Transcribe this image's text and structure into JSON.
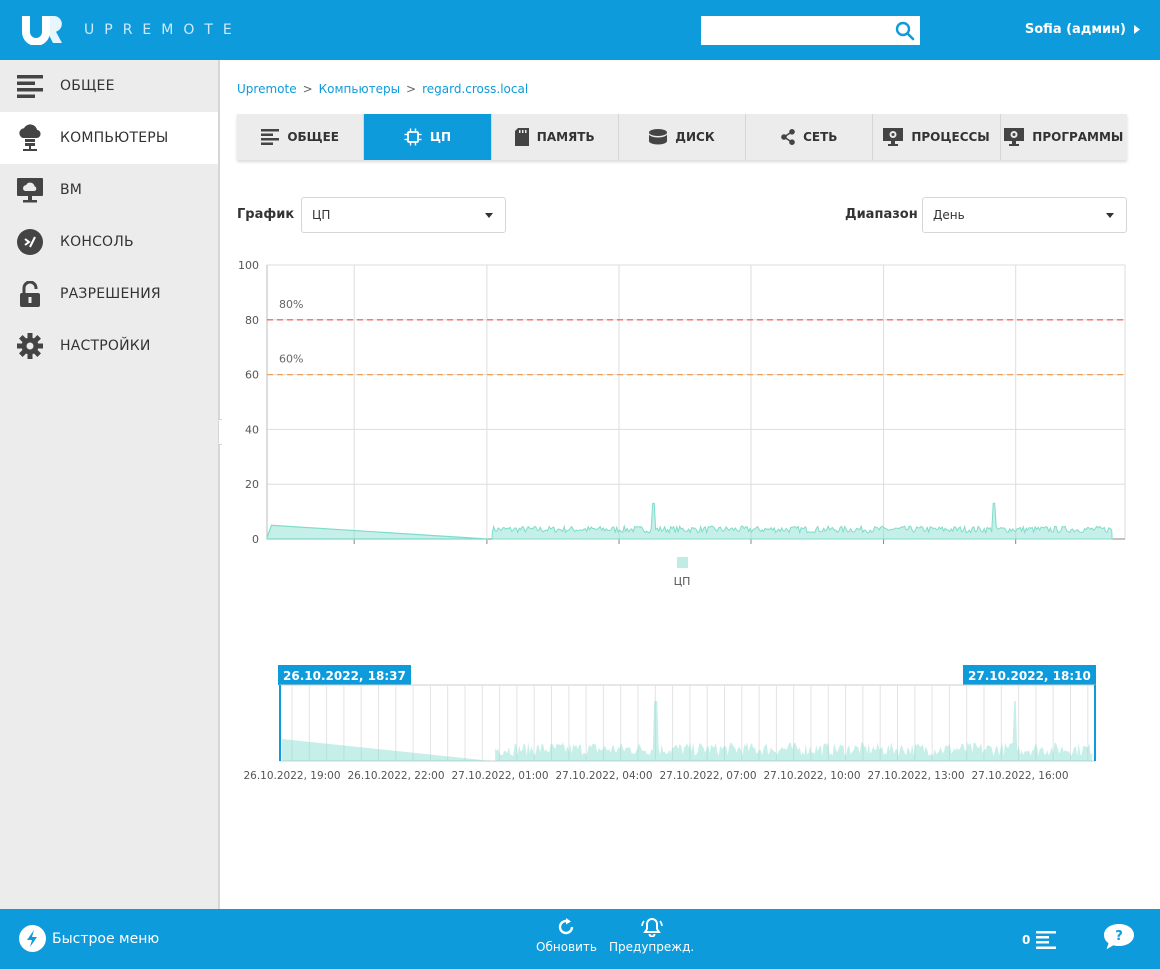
{
  "app": {
    "brand": "UPREMOTE",
    "user_label": "Sofia (админ)",
    "search": {
      "value": "",
      "placeholder": ""
    }
  },
  "sidebar": {
    "items": [
      {
        "label": "ОБЩЕЕ",
        "icon": "list-icon",
        "active": false
      },
      {
        "label": "КОМПЬЮТЕРЫ",
        "icon": "cloud-computer-icon",
        "active": true
      },
      {
        "label": "ВМ",
        "icon": "monitor-cloud-icon",
        "active": false
      },
      {
        "label": "КОНСОЛЬ",
        "icon": "console-icon",
        "active": false
      },
      {
        "label": "РАЗРЕШЕНИЯ",
        "icon": "lock-icon",
        "active": false
      },
      {
        "label": "НАСТРОЙКИ",
        "icon": "gear-icon",
        "active": false
      }
    ]
  },
  "breadcrumb": {
    "items": [
      "Upremote",
      "Компьютеры",
      "regard.cross.local"
    ],
    "separator": ">"
  },
  "tabs": [
    {
      "label": "ОБЩЕЕ",
      "icon": "list-icon",
      "active": false
    },
    {
      "label": "ЦП",
      "icon": "cpu-icon",
      "active": true
    },
    {
      "label": "ПАМЯТЬ",
      "icon": "memory-card-icon",
      "active": false
    },
    {
      "label": "ДИСК",
      "icon": "disk-icon",
      "active": false
    },
    {
      "label": "СЕТЬ",
      "icon": "share-icon",
      "active": false
    },
    {
      "label": "ПРОЦЕССЫ",
      "icon": "monitor-gear-icon",
      "active": false
    },
    {
      "label": "ПРОГРАММЫ",
      "icon": "monitor-gear-icon",
      "active": false
    }
  ],
  "controls": {
    "graph_label": "График",
    "graph_value": "ЦП",
    "range_label": "Диапазон",
    "range_value": "День"
  },
  "chart_data": [
    {
      "type": "area",
      "ylim": [
        0,
        100
      ],
      "yticks": [
        0,
        20,
        40,
        60,
        80,
        100
      ],
      "thresholds": [
        {
          "value": 80,
          "label": "80%",
          "color": "#f26c6c"
        },
        {
          "value": 60,
          "label": "60%",
          "color": "#f5a15a"
        }
      ],
      "grid": true,
      "legend": "bottom-center",
      "series": [
        {
          "name": "ЦП",
          "color": "#7fdccb",
          "segments": [
            {
              "points": [
                [
                  0.0,
                  0.5
                ],
                [
                  0.0052,
                  5.0
                ],
                [
                  0.2576,
                  0.0
                ]
              ]
            },
            {
              "start": 0.2625,
              "end": 0.985,
              "baseline": 3.5,
              "noise": 1.2,
              "spikes": [
                [
                  0.4505,
                  13.0
                ],
                [
                  0.8473,
                  13.0
                ]
              ]
            }
          ]
        }
      ]
    },
    {
      "type": "area",
      "role": "range-navigator",
      "range_start_label": "26.10.2022, 18:37",
      "range_end_label": "27.10.2022, 18:10",
      "x_tick_labels": [
        "26.10.2022, 19:00",
        "26.10.2022, 22:00",
        "27.10.2022, 01:00",
        "27.10.2022, 04:00",
        "27.10.2022, 07:00",
        "27.10.2022, 10:00",
        "27.10.2022, 13:00",
        "27.10.2022, 16:00"
      ],
      "series": [
        {
          "name": "ЦП",
          "color": "#7fdccb"
        }
      ]
    }
  ],
  "bottom": {
    "quick_menu": "Быстрое меню",
    "refresh": "Обновить",
    "alerts": "Предупрежд.",
    "notification_count": "0"
  },
  "colors": {
    "accent": "#0d9bdc",
    "sidebar_bg": "#ececec",
    "series": "#7fdccb",
    "threshold_high": "#f26c6c",
    "threshold_mid": "#f5a15a"
  }
}
